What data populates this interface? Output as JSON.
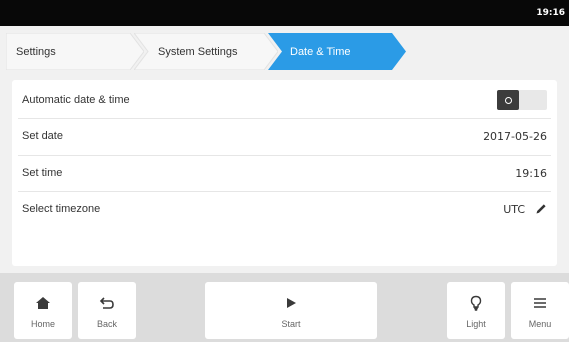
{
  "status_bar": {
    "time": "19:16"
  },
  "breadcrumb": [
    {
      "label": "Settings"
    },
    {
      "label": "System Settings"
    },
    {
      "label": "Date & Time"
    }
  ],
  "settings": {
    "automatic": {
      "label": "Automatic date & time",
      "enabled": false
    },
    "date": {
      "label": "Set date",
      "value": "2017-05-26"
    },
    "time": {
      "label": "Set time",
      "value": "19:16"
    },
    "timezone": {
      "label": "Select timezone",
      "value": "UTC"
    }
  },
  "bottom_nav": {
    "home": "Home",
    "back": "Back",
    "start": "Start",
    "light": "Light",
    "menu": "Menu"
  },
  "colors": {
    "accent": "#2b9be6",
    "status_bar": "#080808",
    "crumb_inactive": "#f7f7f7"
  }
}
